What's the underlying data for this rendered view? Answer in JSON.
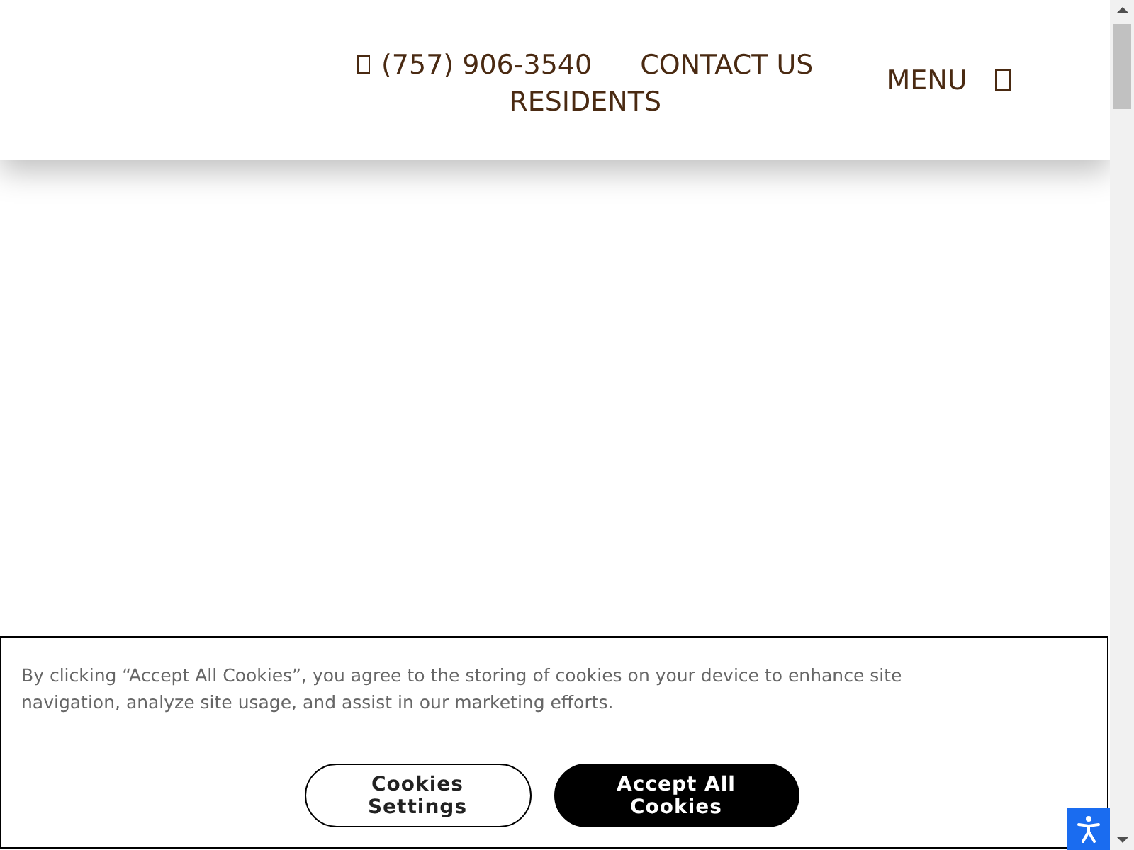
{
  "header": {
    "phone": "(757) 906-3540",
    "links": [
      "CONTACT US",
      "RESIDENTS"
    ],
    "menu": "MENU"
  },
  "cookie_banner": {
    "text": "By clicking “Accept All Cookies”, you agree to the storing of cookies on your device to enhance site navigation, analyze site usage, and assist in our marketing efforts.",
    "buttons": [
      {
        "label": "Cookies Settings",
        "kind": "secondary"
      },
      {
        "label": "Accept All Cookies",
        "kind": "primary"
      }
    ]
  }
}
